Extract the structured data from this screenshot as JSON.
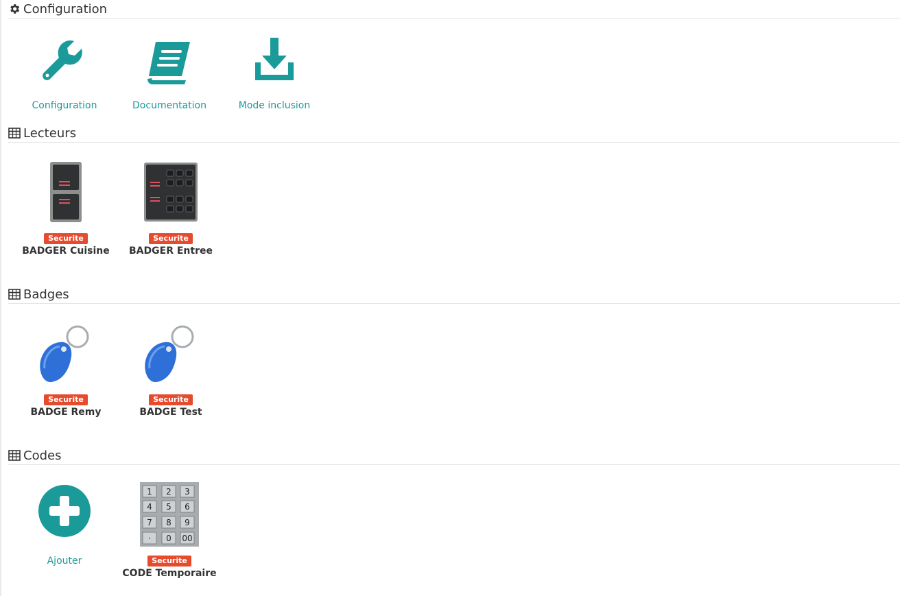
{
  "colors": {
    "accent": "#1a9a99",
    "badge_bg": "#e64b2e",
    "divider": "#e5e5e5"
  },
  "sections": {
    "configuration": {
      "title": "Configuration",
      "icon": "gear-icon",
      "actions": [
        {
          "label": "Configuration",
          "icon": "wrench-icon"
        },
        {
          "label": "Documentation",
          "icon": "book-icon"
        },
        {
          "label": "Mode inclusion",
          "icon": "download-icon"
        }
      ]
    },
    "lecteurs": {
      "title": "Lecteurs",
      "icon": "table-icon",
      "items": [
        {
          "category": "Securite",
          "name": "BADGER Cuisine",
          "icon": "card-reader-icon"
        },
        {
          "category": "Securite",
          "name": "BADGER Entree",
          "icon": "keypad-reader-icon"
        }
      ]
    },
    "badges": {
      "title": "Badges",
      "icon": "table-icon",
      "items": [
        {
          "category": "Securite",
          "name": "BADGE Remy",
          "icon": "rfid-keyfob-icon"
        },
        {
          "category": "Securite",
          "name": "BADGE Test",
          "icon": "rfid-keyfob-icon"
        }
      ]
    },
    "codes": {
      "title": "Codes",
      "icon": "table-icon",
      "add_label": "Ajouter",
      "items": [
        {
          "category": "Securite",
          "name": "CODE Temporaire",
          "icon": "numeric-keypad-icon"
        }
      ]
    }
  }
}
